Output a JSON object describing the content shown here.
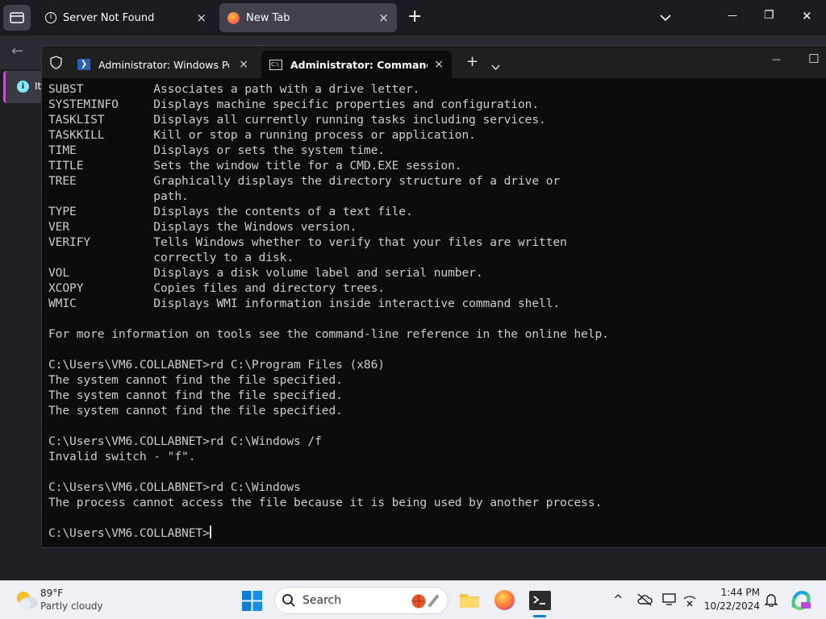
{
  "browser": {
    "tabs": [
      {
        "label": "Server Not Found",
        "close": "×"
      },
      {
        "label": "New Tab",
        "close": "×"
      }
    ],
    "new_tab_icon": "+",
    "list_all_tabs_icon": "chevron-down-icon",
    "window_controls": {
      "minimize": "—",
      "restore": "❐",
      "close": "✕"
    },
    "back_icon": "←",
    "infobar_text": "It"
  },
  "terminal": {
    "tabs": [
      {
        "label": "Administrator: Windows PowerShell",
        "close": "×"
      },
      {
        "label": "Administrator: Command Pro",
        "close": "×"
      }
    ],
    "new_tab": "+",
    "dropdown": "⌄",
    "window_controls": {
      "minimize": "—",
      "maximize": "☐"
    },
    "lines": [
      "SUBST          Associates a path with a drive letter.",
      "SYSTEMINFO     Displays machine specific properties and configuration.",
      "TASKLIST       Displays all currently running tasks including services.",
      "TASKKILL       Kill or stop a running process or application.",
      "TIME           Displays or sets the system time.",
      "TITLE          Sets the window title for a CMD.EXE session.",
      "TREE           Graphically displays the directory structure of a drive or",
      "               path.",
      "TYPE           Displays the contents of a text file.",
      "VER            Displays the Windows version.",
      "VERIFY         Tells Windows whether to verify that your files are written",
      "               correctly to a disk.",
      "VOL            Displays a disk volume label and serial number.",
      "XCOPY          Copies files and directory trees.",
      "WMIC           Displays WMI information inside interactive command shell.",
      "",
      "For more information on tools see the command-line reference in the online help.",
      "",
      "C:\\Users\\VM6.COLLABNET>rd C:\\Program Files (x86)",
      "The system cannot find the file specified.",
      "The system cannot find the file specified.",
      "The system cannot find the file specified.",
      "",
      "C:\\Users\\VM6.COLLABNET>rd C:\\Windows /f",
      "Invalid switch - \"f\".",
      "",
      "C:\\Users\\VM6.COLLABNET>rd C:\\Windows",
      "The process cannot access the file because it is being used by another process.",
      ""
    ],
    "prompt": "C:\\Users\\VM6.COLLABNET>"
  },
  "taskbar": {
    "weather": {
      "temp": "89°F",
      "condition": "Partly cloudy"
    },
    "search_placeholder": "Search",
    "clock": {
      "time": "1:44 PM",
      "date": "10/22/2024"
    },
    "chevron_up": "^",
    "colors": {
      "windows_blue": "#0a7fd6",
      "firefox_orange": "#ff7139",
      "folder_yellow": "#f6c343"
    }
  }
}
